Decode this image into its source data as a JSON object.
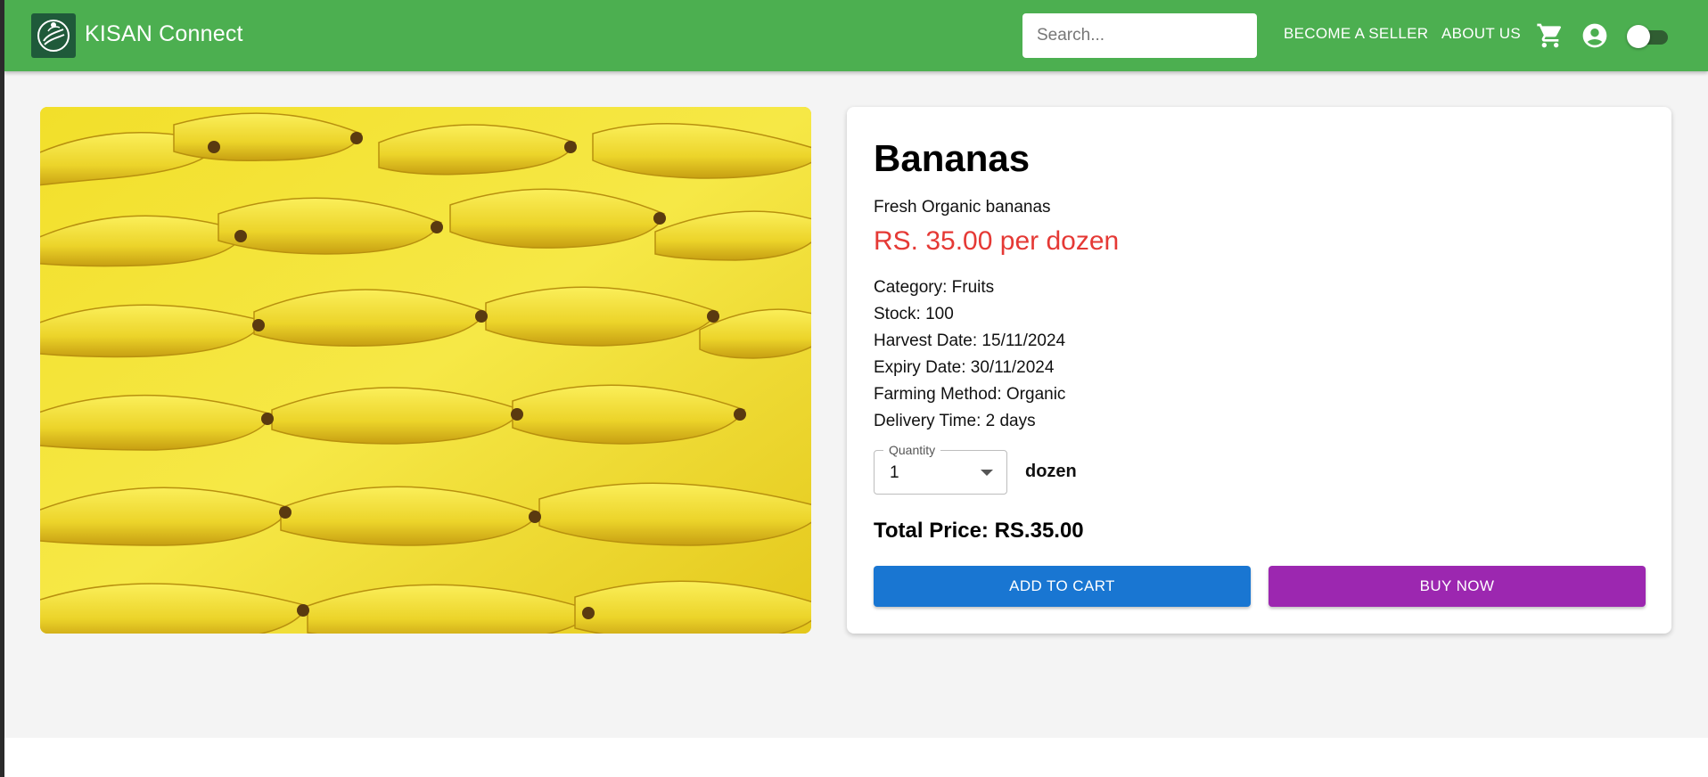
{
  "header": {
    "brand": "KISAN Connect",
    "search_placeholder": "Search...",
    "nav": {
      "become_seller": "BECOME A SELLER",
      "about_us": "ABOUT US"
    },
    "icons": [
      "cart-icon",
      "account-circle-icon"
    ],
    "theme_toggle_on": false
  },
  "product": {
    "image_alt": "Bananas",
    "name": "Bananas",
    "description": "Fresh Organic bananas",
    "price": "RS. 35.00 per dozen",
    "details": {
      "category": "Category: Fruits",
      "stock": "Stock: 100",
      "harvest": "Harvest Date: 15/11/2024",
      "expiry": "Expiry Date: 30/11/2024",
      "method": "Farming Method: Organic",
      "delivery": "Delivery Time: 2 days"
    },
    "quantity": {
      "label": "Quantity",
      "value": "1",
      "unit": "dozen"
    },
    "total": "Total Price: RS.35.00",
    "buttons": {
      "add_to_cart": "ADD TO CART",
      "buy_now": "BUY NOW"
    }
  },
  "colors": {
    "appbar": "#4caf50",
    "price": "#e53935",
    "add_to_cart": "#1976d2",
    "buy_now": "#9c27b0",
    "background": "#f4f4f4"
  }
}
